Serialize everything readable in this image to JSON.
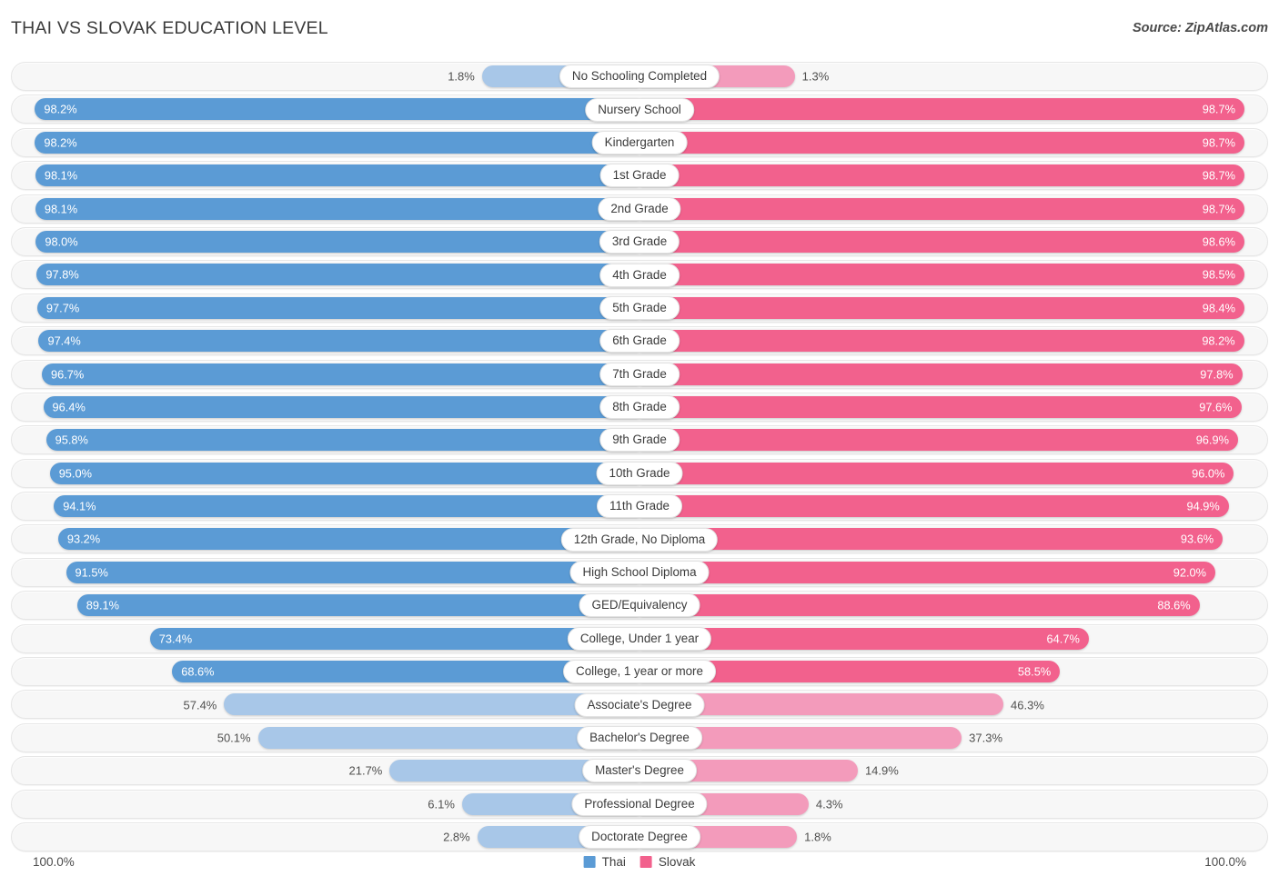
{
  "header": {
    "title": "THAI VS SLOVAK EDUCATION LEVEL",
    "source": "Source: ZipAtlas.com"
  },
  "legend": {
    "items": [
      {
        "label": "Thai",
        "color": "#5b9bd5"
      },
      {
        "label": "Slovak",
        "color": "#f2618d"
      }
    ]
  },
  "axis": {
    "left_label": "100.0%",
    "right_label": "100.0%"
  },
  "colors": {
    "thai_strong": "#5b9bd5",
    "thai_light": "#a8c7e8",
    "slovak_strong": "#f2618d",
    "slovak_light": "#f39bbb",
    "track_fill": "#f7f7f7",
    "track_border": "#e6e6e6"
  },
  "chart_data": {
    "type": "bar",
    "title": "THAI VS SLOVAK EDUCATION LEVEL",
    "xlabel": "",
    "ylabel": "",
    "orientation": "horizontal-diverging",
    "axis_max": 100.0,
    "legend_position": "bottom-center",
    "grid": false,
    "categories": [
      "No Schooling Completed",
      "Nursery School",
      "Kindergarten",
      "1st Grade",
      "2nd Grade",
      "3rd Grade",
      "4th Grade",
      "5th Grade",
      "6th Grade",
      "7th Grade",
      "8th Grade",
      "9th Grade",
      "10th Grade",
      "11th Grade",
      "12th Grade, No Diploma",
      "High School Diploma",
      "GED/Equivalency",
      "College, Under 1 year",
      "College, 1 year or more",
      "Associate's Degree",
      "Bachelor's Degree",
      "Master's Degree",
      "Professional Degree",
      "Doctorate Degree"
    ],
    "series": [
      {
        "name": "Thai",
        "color": "#5b9bd5",
        "values": [
          1.8,
          98.2,
          98.2,
          98.1,
          98.1,
          98.0,
          97.8,
          97.7,
          97.4,
          96.7,
          96.4,
          95.8,
          95.0,
          94.1,
          93.2,
          91.5,
          89.1,
          73.4,
          68.6,
          57.4,
          50.1,
          21.7,
          6.1,
          2.8
        ],
        "labels": [
          "1.8%",
          "98.2%",
          "98.2%",
          "98.1%",
          "98.1%",
          "98.0%",
          "97.8%",
          "97.7%",
          "97.4%",
          "96.7%",
          "96.4%",
          "95.8%",
          "95.0%",
          "94.1%",
          "93.2%",
          "91.5%",
          "89.1%",
          "73.4%",
          "68.6%",
          "57.4%",
          "50.1%",
          "21.7%",
          "6.1%",
          "2.8%"
        ]
      },
      {
        "name": "Slovak",
        "color": "#f2618d",
        "values": [
          1.3,
          98.7,
          98.7,
          98.7,
          98.7,
          98.6,
          98.5,
          98.4,
          98.2,
          97.8,
          97.6,
          96.9,
          96.0,
          94.9,
          93.6,
          92.0,
          88.6,
          64.7,
          58.5,
          46.3,
          37.3,
          14.9,
          4.3,
          1.8
        ],
        "labels": [
          "1.3%",
          "98.7%",
          "98.7%",
          "98.7%",
          "98.7%",
          "98.6%",
          "98.5%",
          "98.4%",
          "98.2%",
          "97.8%",
          "97.6%",
          "96.9%",
          "96.0%",
          "94.9%",
          "93.6%",
          "92.0%",
          "88.6%",
          "64.7%",
          "58.5%",
          "46.3%",
          "37.3%",
          "14.9%",
          "4.3%",
          "1.8%"
        ]
      }
    ]
  }
}
